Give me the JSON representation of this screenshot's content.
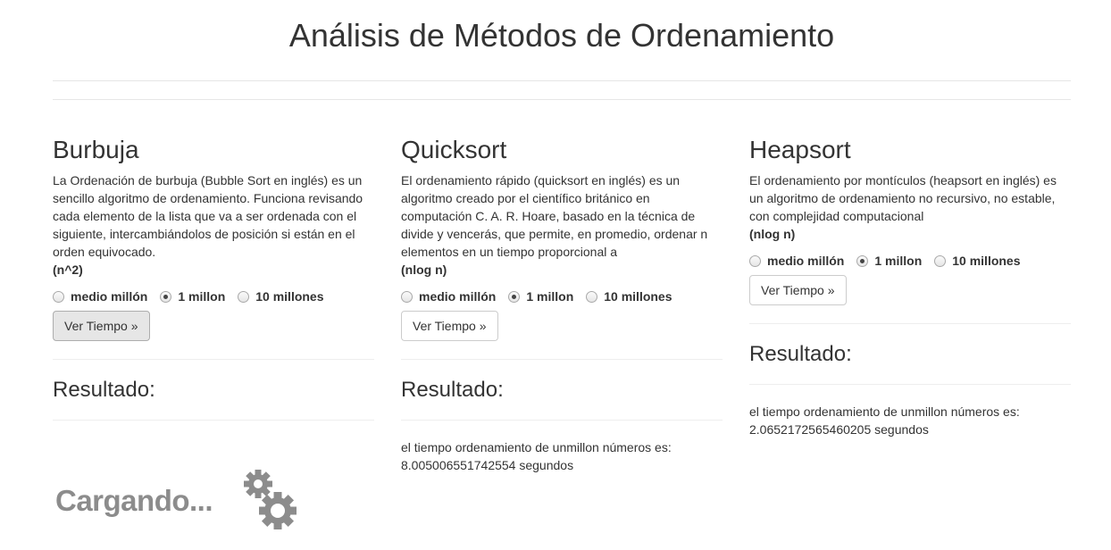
{
  "page": {
    "title": "Análisis de Métodos de Ordenamiento"
  },
  "columns": [
    {
      "title": "Burbuja",
      "description": "La Ordenación de burbuja (Bubble Sort en inglés) es un sencillo algoritmo de ordenamiento. Funciona revisando cada elemento de la lista que va a ser ordenada con el siguiente, intercambiándolos de posición si están en el orden equivocado.",
      "complexity": "(n^2)",
      "options": [
        {
          "label": "medio millón",
          "checked": false
        },
        {
          "label": "1 millon",
          "checked": true
        },
        {
          "label": "10 millones",
          "checked": false
        }
      ],
      "button_label": "Ver Tiempo »",
      "result_title": "Resultado:",
      "result_line1": "",
      "result_line2": ""
    },
    {
      "title": "Quicksort",
      "description": "El ordenamiento rápido (quicksort en inglés) es un algoritmo creado por el científico británico en computación C. A. R. Hoare, basado en la técnica de divide y vencerás, que permite, en promedio, ordenar n elementos en un tiempo proporcional a",
      "complexity": "(nlog n)",
      "options": [
        {
          "label": "medio millón",
          "checked": false
        },
        {
          "label": "1 millon",
          "checked": true
        },
        {
          "label": "10 millones",
          "checked": false
        }
      ],
      "button_label": "Ver Tiempo »",
      "result_title": "Resultado:",
      "result_line1": "el tiempo ordenamiento de unmillon números es:",
      "result_line2": "8.005006551742554 segundos"
    },
    {
      "title": "Heapsort",
      "description": "El ordenamiento por montículos (heapsort en inglés) es un algoritmo de ordenamiento no recursivo, no estable, con complejidad computacional",
      "complexity": "(nlog n)",
      "options": [
        {
          "label": "medio millón",
          "checked": false
        },
        {
          "label": "1 millon",
          "checked": true
        },
        {
          "label": "10 millones",
          "checked": false
        }
      ],
      "button_label": "Ver Tiempo »",
      "result_title": "Resultado:",
      "result_line1": "el tiempo ordenamiento de unmillon números es:",
      "result_line2": "2.0652172565460205 segundos"
    }
  ],
  "loading": {
    "text": "Cargando...",
    "icon": "gears-icon",
    "color": "#8c8c8c"
  }
}
